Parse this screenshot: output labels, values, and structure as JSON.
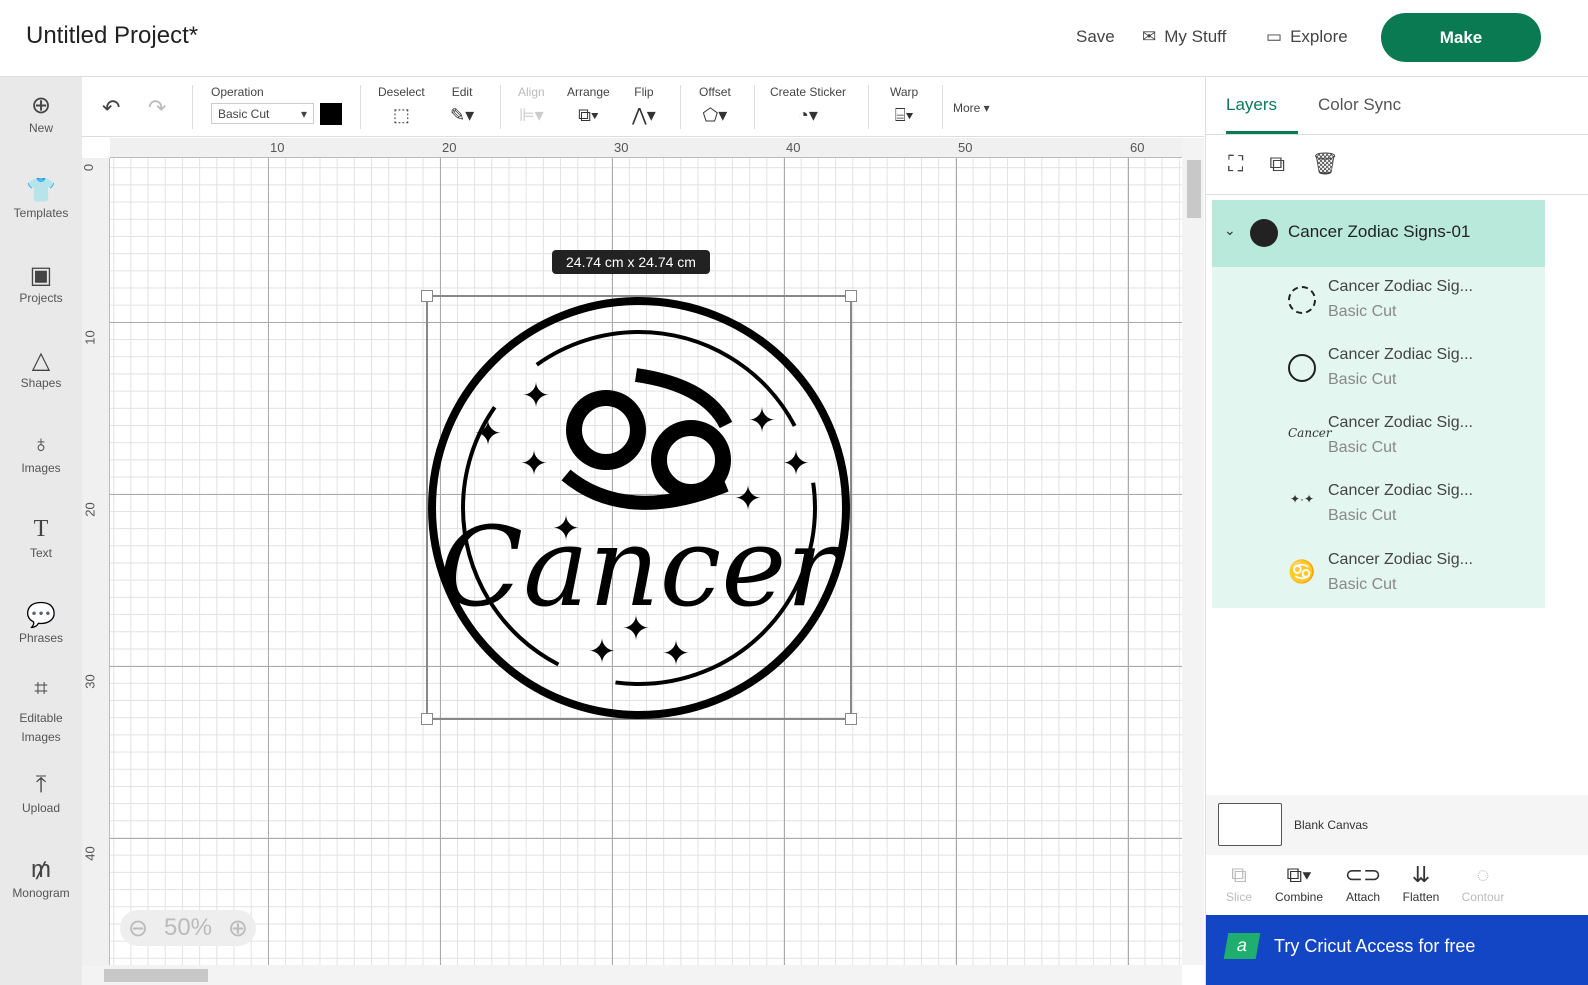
{
  "header": {
    "title": "Untitled Project*",
    "save": "Save",
    "my_stuff": "My Stuff",
    "explore": "Explore",
    "make": "Make"
  },
  "sidebar": [
    "New",
    "Templates",
    "Projects",
    "Shapes",
    "Images",
    "Text",
    "Phrases",
    "Editable Images",
    "Upload",
    "Monogram"
  ],
  "toolbar": {
    "operation_label": "Operation",
    "operation_value": "Basic Cut",
    "deselect": "Deselect",
    "edit": "Edit",
    "align": "Align",
    "arrange": "Arrange",
    "flip": "Flip",
    "offset": "Offset",
    "create_sticker": "Create Sticker",
    "warp": "Warp",
    "more": "More"
  },
  "ruler": {
    "top": [
      "10",
      "20",
      "30",
      "40",
      "50",
      "60"
    ],
    "left": [
      "0",
      "10",
      "20",
      "30",
      "40"
    ]
  },
  "canvas": {
    "size_label": "24.74  cm x 24.74  cm",
    "design_text": "Cancer",
    "zoom": "50%"
  },
  "panel": {
    "tabs": [
      "Layers",
      "Color Sync"
    ],
    "group": "Cancer Zodiac Signs-01",
    "layers": [
      {
        "name": "Cancer Zodiac Sig...",
        "op": "Basic Cut"
      },
      {
        "name": "Cancer Zodiac Sig...",
        "op": "Basic Cut"
      },
      {
        "name": "Cancer Zodiac Sig...",
        "op": "Basic Cut"
      },
      {
        "name": "Cancer Zodiac Sig...",
        "op": "Basic Cut"
      },
      {
        "name": "Cancer Zodiac Sig...",
        "op": "Basic Cut"
      }
    ],
    "blank_canvas": "Blank Canvas",
    "actions": [
      "Slice",
      "Combine",
      "Attach",
      "Flatten",
      "Contour"
    ],
    "promo": "Try Cricut Access for free",
    "promo_badge": "a"
  },
  "colors": {
    "accent": "#0a7a53",
    "layer_bg": "#e3f6ef",
    "group_bg": "#b9e9da",
    "promo": "#1346c4"
  }
}
